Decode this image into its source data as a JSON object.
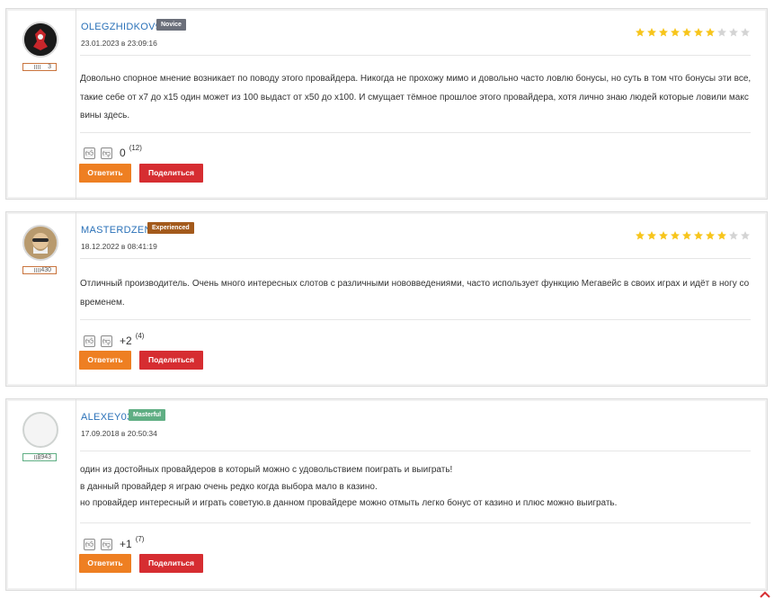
{
  "comments": [
    {
      "username": "OLEGZHIDKOV9",
      "rank": "Novice",
      "rank_color": "#6b6f7a",
      "date": "23.01.2023 в 23:09:16",
      "count": "3",
      "rating_filled": 7,
      "rating_max": 10,
      "text": "Довольно спорное мнение возникает по поводу этого провайдера. Никогда не прохожу мимо и довольно часто ловлю бонусы, но суть в том что бонусы эти все, такие себе от х7 до х15 один может из 100 выдаст от х50 до х100. И смущает тёмное прошлое этого провайдера, хотя лично знаю людей которые ловили макс вины здесь.",
      "score": "0",
      "votes": "(12)",
      "reply_label": "Ответить",
      "share_label": "Поделиться"
    },
    {
      "username": "MASTERDZEN",
      "rank": "Experienced",
      "rank_color": "#a35a1c",
      "date": "18.12.2022 в 08:41:19",
      "count": "430",
      "rating_filled": 8,
      "rating_max": 10,
      "text": "Отличный производитель. Очень много интересных слотов с различными нововведениями, часто использует функцию Мегавейс в своих играх и идёт в ногу со временем.",
      "score": "+2",
      "votes": "(4)",
      "reply_label": "Ответить",
      "share_label": "Поделиться"
    },
    {
      "username": "ALEXEY03",
      "rank": "Masterful",
      "rank_color": "#5fae83",
      "date": "17.09.2018 в 20:50:34",
      "count": "2943",
      "rating_filled": 0,
      "rating_max": 0,
      "text_lines": [
        "один из достойных провайдеров в который можно с удовольствием поиграть и выиграть!",
        "в данный провайдер я играю очень редко когда выбора мало в казино.",
        "но провайдер интересный и играть советую.в данном провайдере можно отмыть легко бонус от казино и плюс можно выиграть."
      ],
      "score": "+1",
      "votes": "(7)",
      "reply_label": "Ответить",
      "share_label": "Поделиться"
    }
  ],
  "colors": {
    "star_filled": "#f7c51b",
    "star_empty": "#d4d4d4",
    "link": "#2a71b8",
    "reply": "#ee7f22",
    "share": "#d62d31"
  }
}
